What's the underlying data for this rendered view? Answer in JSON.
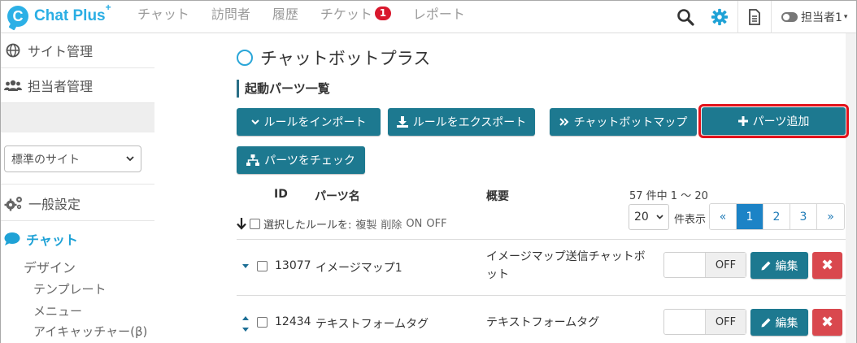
{
  "app": {
    "logo_text": "Chat Plus",
    "logo_plus": "+",
    "logo_letter": "C"
  },
  "nav": {
    "items": [
      {
        "label": "チャット"
      },
      {
        "label": "訪問者"
      },
      {
        "label": "履歴"
      },
      {
        "label": "チケット",
        "badge": "1"
      },
      {
        "label": "レポート"
      }
    ]
  },
  "header_right": {
    "user_label": "担当者1",
    "caret": "▾"
  },
  "sidebar": {
    "site_admin": "サイト管理",
    "agent_admin": "担当者管理",
    "site_select": "標準のサイト",
    "general_settings": "一般設定",
    "chat": "チャット",
    "design": "デザイン",
    "template": "テンプレート",
    "menu": "メニュー",
    "eye_catcher": "アイキャッチャー(β)"
  },
  "main": {
    "title": "チャットボットプラス",
    "section": "起動パーツ一覧",
    "buttons": {
      "import": "ルールをインポート",
      "export": "ルールをエクスポート",
      "map": "チャットボットマップ",
      "add": "パーツ追加",
      "check": "パーツをチェック"
    },
    "columns": {
      "id": "ID",
      "name": "パーツ名",
      "summary": "概要"
    },
    "bulk": {
      "label": "選択したルールを:",
      "duplicate": "複製",
      "delete": "削除",
      "on": "ON",
      "off": "OFF"
    },
    "pagination": {
      "count_text": "57 件中 1 〜 20",
      "per_page": "20",
      "per_page_label": "件表示",
      "prev": "«",
      "pages": [
        "1",
        "2",
        "3"
      ],
      "next": "»",
      "active_page": "1"
    },
    "rows": [
      {
        "id": "13077",
        "name": "イメージマップ1",
        "summary_line1": "イメージマップ送信チャットボ",
        "summary_line2": "ット",
        "toggle": "OFF",
        "edit": "編集",
        "delete": "✖"
      },
      {
        "id": "12434",
        "name": "テキストフォームタグ",
        "summary_line1": "テキストフォームタグ",
        "summary_line2": "",
        "toggle": "OFF",
        "edit": "編集",
        "delete": "✖"
      }
    ]
  },
  "colors": {
    "brand": "#2aaee4",
    "button": "#1d7990",
    "danger": "#d9484e",
    "highlight": "#e3121b",
    "badge": "#d9182d",
    "pager_active": "#1c83c6"
  }
}
